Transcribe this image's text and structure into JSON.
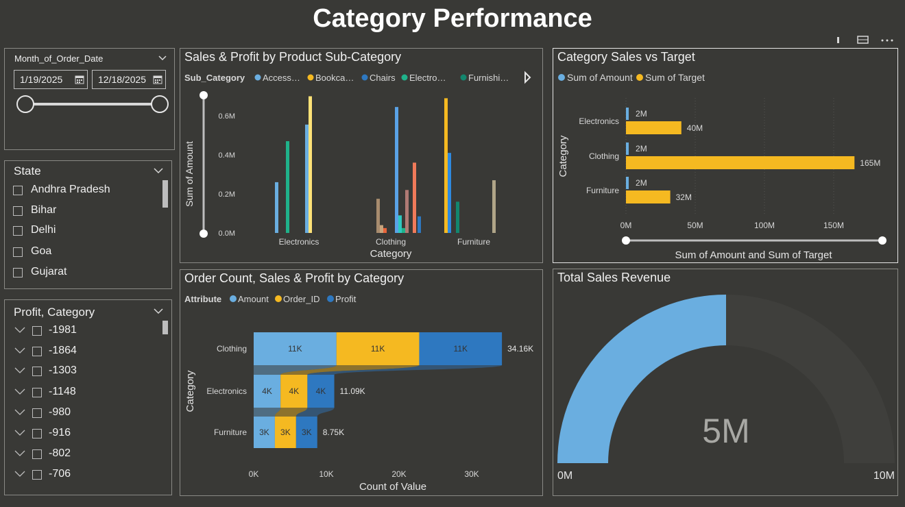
{
  "page": {
    "title": "Category Performance"
  },
  "date_slicer": {
    "label": "Month_of_Order_Date",
    "start": "1/19/2025",
    "end": "12/18/2025"
  },
  "state_slicer": {
    "label": "State",
    "items": [
      "Andhra Pradesh",
      "Bihar",
      "Delhi",
      "Goa",
      "Gujarat"
    ]
  },
  "profit_slicer": {
    "label": "Profit, Category",
    "items": [
      "-1981",
      "-1864",
      "-1303",
      "-1148",
      "-980",
      "-916",
      "-802",
      "-706"
    ]
  },
  "colors": {
    "amount": "#6aaee0",
    "target": "#f5b921",
    "profit": "#2e78c0",
    "gauge": "#6aaee0"
  },
  "chart_data": [
    {
      "type": "bar",
      "title": "Sales & Profit by Product Sub-Category",
      "legend_title": "Sub_Category",
      "legend": [
        {
          "name": "Access…",
          "color": "#6aaee0"
        },
        {
          "name": "Bookca…",
          "color": "#f5b921"
        },
        {
          "name": "Chairs",
          "color": "#2e78c0"
        },
        {
          "name": "Electro…",
          "color": "#1fb28a"
        },
        {
          "name": "Furnishi…",
          "color": "#13866e"
        }
      ],
      "categories": [
        "Electronics",
        "Clothing",
        "Furniture"
      ],
      "groups": [
        {
          "category": "Electronics",
          "bars": [
            {
              "color": "#6aaee0",
              "value": 0.26
            },
            {
              "color": "#1fb28a",
              "value": 0.47
            },
            {
              "color": "#6aaee0",
              "value": 0.555
            },
            {
              "color": "#ffe277",
              "value": 0.7
            }
          ]
        },
        {
          "category": "Clothing",
          "bars": [
            {
              "color": "#a88c6e",
              "value": 0.175
            },
            {
              "color": "#c9a47c",
              "value": 0.04
            },
            {
              "color": "#e9643a",
              "value": 0.025
            },
            {
              "color": "#5aa2e6",
              "value": 0.645
            },
            {
              "color": "#2ec9c0",
              "value": 0.09
            },
            {
              "color": "#1fb28a",
              "value": 0.025
            },
            {
              "color": "#b07a74",
              "value": 0.22
            },
            {
              "color": "#f07a5a",
              "value": 0.36
            },
            {
              "color": "#2e78c0",
              "value": 0.085
            }
          ]
        },
        {
          "category": "Furniture",
          "bars": [
            {
              "color": "#f5b921",
              "value": 0.69
            },
            {
              "color": "#2e8ae0",
              "value": 0.41
            },
            {
              "color": "#13866e",
              "value": 0.16
            },
            {
              "color": "#b0a588",
              "value": 0.27
            }
          ]
        }
      ],
      "ylabel": "Sum of Amount",
      "xlabel": "Category",
      "yticks": [
        "0.0M",
        "0.2M",
        "0.4M",
        "0.6M"
      ],
      "ylim": [
        0,
        0.7
      ]
    },
    {
      "type": "bar",
      "orientation": "horizontal",
      "title": "Category Sales vs Target",
      "categories": [
        "Electronics",
        "Clothing",
        "Furniture"
      ],
      "series": [
        {
          "name": "Sum of Amount",
          "values": [
            2,
            2,
            2
          ],
          "labels": [
            "2M",
            "2M",
            "2M"
          ]
        },
        {
          "name": "Sum of Target",
          "values": [
            40,
            165,
            32
          ],
          "labels": [
            "40M",
            "165M",
            "32M"
          ]
        }
      ],
      "xticks": [
        "0M",
        "50M",
        "100M",
        "150M"
      ],
      "xlim": [
        0,
        180
      ],
      "xlabel": "Sum of Amount and Sum of Target",
      "ylabel": "Category"
    },
    {
      "type": "bar",
      "orientation": "horizontal-stacked",
      "title": "Order Count, Sales & Profit by Category",
      "legend_title": "Attribute",
      "categories": [
        "Clothing",
        "Electronics",
        "Furniture"
      ],
      "series": [
        {
          "name": "Amount",
          "values": [
            11390,
            3697,
            2917
          ],
          "labels": [
            "11K",
            "4K",
            "3K"
          ]
        },
        {
          "name": "Order_ID",
          "values": [
            11390,
            3697,
            2917
          ],
          "labels": [
            "11K",
            "4K",
            "3K"
          ]
        },
        {
          "name": "Profit",
          "values": [
            11380,
            3696,
            2916
          ],
          "labels": [
            "11K",
            "4K",
            "3K"
          ]
        }
      ],
      "totals": [
        "34.16K",
        "11.09K",
        "8.75K"
      ],
      "xticks": [
        "0K",
        "10K",
        "20K",
        "30K"
      ],
      "xlim": [
        0,
        30000
      ],
      "xlabel": "Count of Value",
      "ylabel": "Category"
    },
    {
      "type": "gauge",
      "title": "Total Sales Revenue",
      "value": 5,
      "value_label": "5M",
      "min_label": "0M",
      "max_label": "10M",
      "min": 0,
      "max": 10
    }
  ]
}
